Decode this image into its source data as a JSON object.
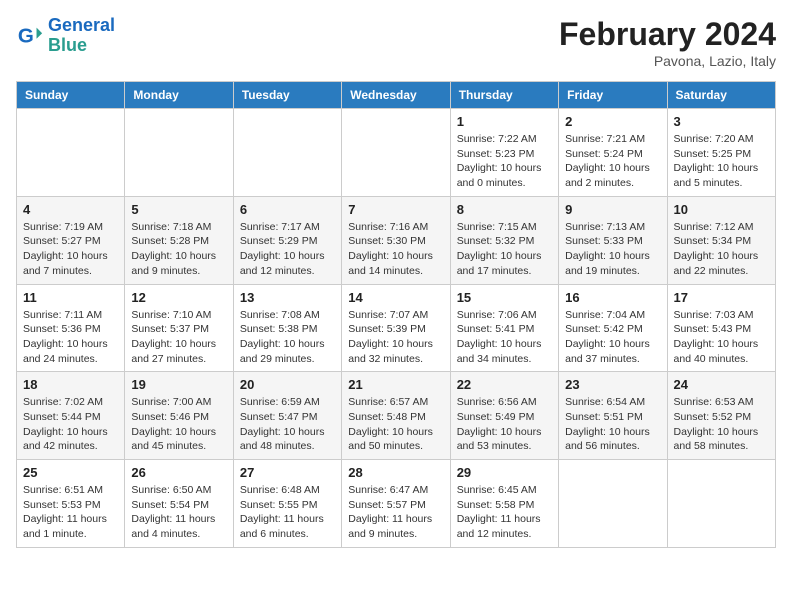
{
  "header": {
    "logo_line1": "General",
    "logo_line2": "Blue",
    "month_title": "February 2024",
    "subtitle": "Pavona, Lazio, Italy"
  },
  "days_of_week": [
    "Sunday",
    "Monday",
    "Tuesday",
    "Wednesday",
    "Thursday",
    "Friday",
    "Saturday"
  ],
  "weeks": [
    [
      {
        "num": "",
        "info": ""
      },
      {
        "num": "",
        "info": ""
      },
      {
        "num": "",
        "info": ""
      },
      {
        "num": "",
        "info": ""
      },
      {
        "num": "1",
        "info": "Sunrise: 7:22 AM\nSunset: 5:23 PM\nDaylight: 10 hours and 0 minutes."
      },
      {
        "num": "2",
        "info": "Sunrise: 7:21 AM\nSunset: 5:24 PM\nDaylight: 10 hours and 2 minutes."
      },
      {
        "num": "3",
        "info": "Sunrise: 7:20 AM\nSunset: 5:25 PM\nDaylight: 10 hours and 5 minutes."
      }
    ],
    [
      {
        "num": "4",
        "info": "Sunrise: 7:19 AM\nSunset: 5:27 PM\nDaylight: 10 hours and 7 minutes."
      },
      {
        "num": "5",
        "info": "Sunrise: 7:18 AM\nSunset: 5:28 PM\nDaylight: 10 hours and 9 minutes."
      },
      {
        "num": "6",
        "info": "Sunrise: 7:17 AM\nSunset: 5:29 PM\nDaylight: 10 hours and 12 minutes."
      },
      {
        "num": "7",
        "info": "Sunrise: 7:16 AM\nSunset: 5:30 PM\nDaylight: 10 hours and 14 minutes."
      },
      {
        "num": "8",
        "info": "Sunrise: 7:15 AM\nSunset: 5:32 PM\nDaylight: 10 hours and 17 minutes."
      },
      {
        "num": "9",
        "info": "Sunrise: 7:13 AM\nSunset: 5:33 PM\nDaylight: 10 hours and 19 minutes."
      },
      {
        "num": "10",
        "info": "Sunrise: 7:12 AM\nSunset: 5:34 PM\nDaylight: 10 hours and 22 minutes."
      }
    ],
    [
      {
        "num": "11",
        "info": "Sunrise: 7:11 AM\nSunset: 5:36 PM\nDaylight: 10 hours and 24 minutes."
      },
      {
        "num": "12",
        "info": "Sunrise: 7:10 AM\nSunset: 5:37 PM\nDaylight: 10 hours and 27 minutes."
      },
      {
        "num": "13",
        "info": "Sunrise: 7:08 AM\nSunset: 5:38 PM\nDaylight: 10 hours and 29 minutes."
      },
      {
        "num": "14",
        "info": "Sunrise: 7:07 AM\nSunset: 5:39 PM\nDaylight: 10 hours and 32 minutes."
      },
      {
        "num": "15",
        "info": "Sunrise: 7:06 AM\nSunset: 5:41 PM\nDaylight: 10 hours and 34 minutes."
      },
      {
        "num": "16",
        "info": "Sunrise: 7:04 AM\nSunset: 5:42 PM\nDaylight: 10 hours and 37 minutes."
      },
      {
        "num": "17",
        "info": "Sunrise: 7:03 AM\nSunset: 5:43 PM\nDaylight: 10 hours and 40 minutes."
      }
    ],
    [
      {
        "num": "18",
        "info": "Sunrise: 7:02 AM\nSunset: 5:44 PM\nDaylight: 10 hours and 42 minutes."
      },
      {
        "num": "19",
        "info": "Sunrise: 7:00 AM\nSunset: 5:46 PM\nDaylight: 10 hours and 45 minutes."
      },
      {
        "num": "20",
        "info": "Sunrise: 6:59 AM\nSunset: 5:47 PM\nDaylight: 10 hours and 48 minutes."
      },
      {
        "num": "21",
        "info": "Sunrise: 6:57 AM\nSunset: 5:48 PM\nDaylight: 10 hours and 50 minutes."
      },
      {
        "num": "22",
        "info": "Sunrise: 6:56 AM\nSunset: 5:49 PM\nDaylight: 10 hours and 53 minutes."
      },
      {
        "num": "23",
        "info": "Sunrise: 6:54 AM\nSunset: 5:51 PM\nDaylight: 10 hours and 56 minutes."
      },
      {
        "num": "24",
        "info": "Sunrise: 6:53 AM\nSunset: 5:52 PM\nDaylight: 10 hours and 58 minutes."
      }
    ],
    [
      {
        "num": "25",
        "info": "Sunrise: 6:51 AM\nSunset: 5:53 PM\nDaylight: 11 hours and 1 minute."
      },
      {
        "num": "26",
        "info": "Sunrise: 6:50 AM\nSunset: 5:54 PM\nDaylight: 11 hours and 4 minutes."
      },
      {
        "num": "27",
        "info": "Sunrise: 6:48 AM\nSunset: 5:55 PM\nDaylight: 11 hours and 6 minutes."
      },
      {
        "num": "28",
        "info": "Sunrise: 6:47 AM\nSunset: 5:57 PM\nDaylight: 11 hours and 9 minutes."
      },
      {
        "num": "29",
        "info": "Sunrise: 6:45 AM\nSunset: 5:58 PM\nDaylight: 11 hours and 12 minutes."
      },
      {
        "num": "",
        "info": ""
      },
      {
        "num": "",
        "info": ""
      }
    ]
  ]
}
